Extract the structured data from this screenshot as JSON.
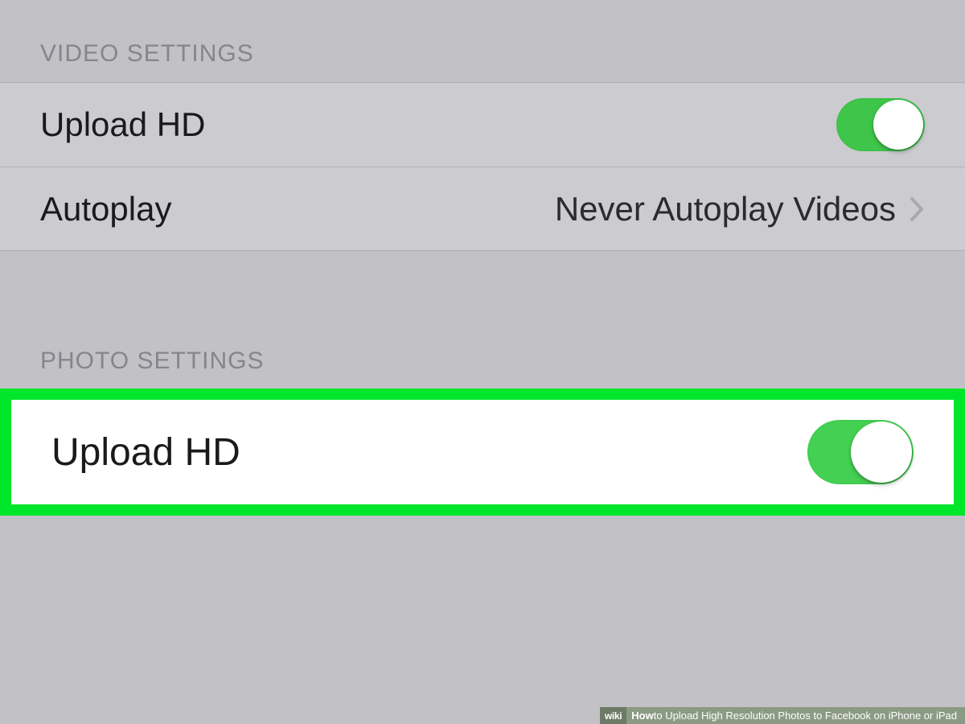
{
  "sections": {
    "video": {
      "header": "VIDEO SETTINGS",
      "rows": {
        "uploadHD": {
          "label": "Upload HD",
          "on": true
        },
        "autoplay": {
          "label": "Autoplay",
          "value": "Never Autoplay Videos"
        }
      }
    },
    "photo": {
      "header": "PHOTO SETTINGS",
      "rows": {
        "uploadHD": {
          "label": "Upload HD",
          "on": true
        }
      }
    }
  },
  "caption": {
    "brandPrefix": "wiki",
    "brandSuffix": "How",
    "text": " to Upload High Resolution Photos to Facebook on iPhone or iPad"
  },
  "colors": {
    "toggleOn": "#3fc64a",
    "highlight": "#00e62a"
  }
}
